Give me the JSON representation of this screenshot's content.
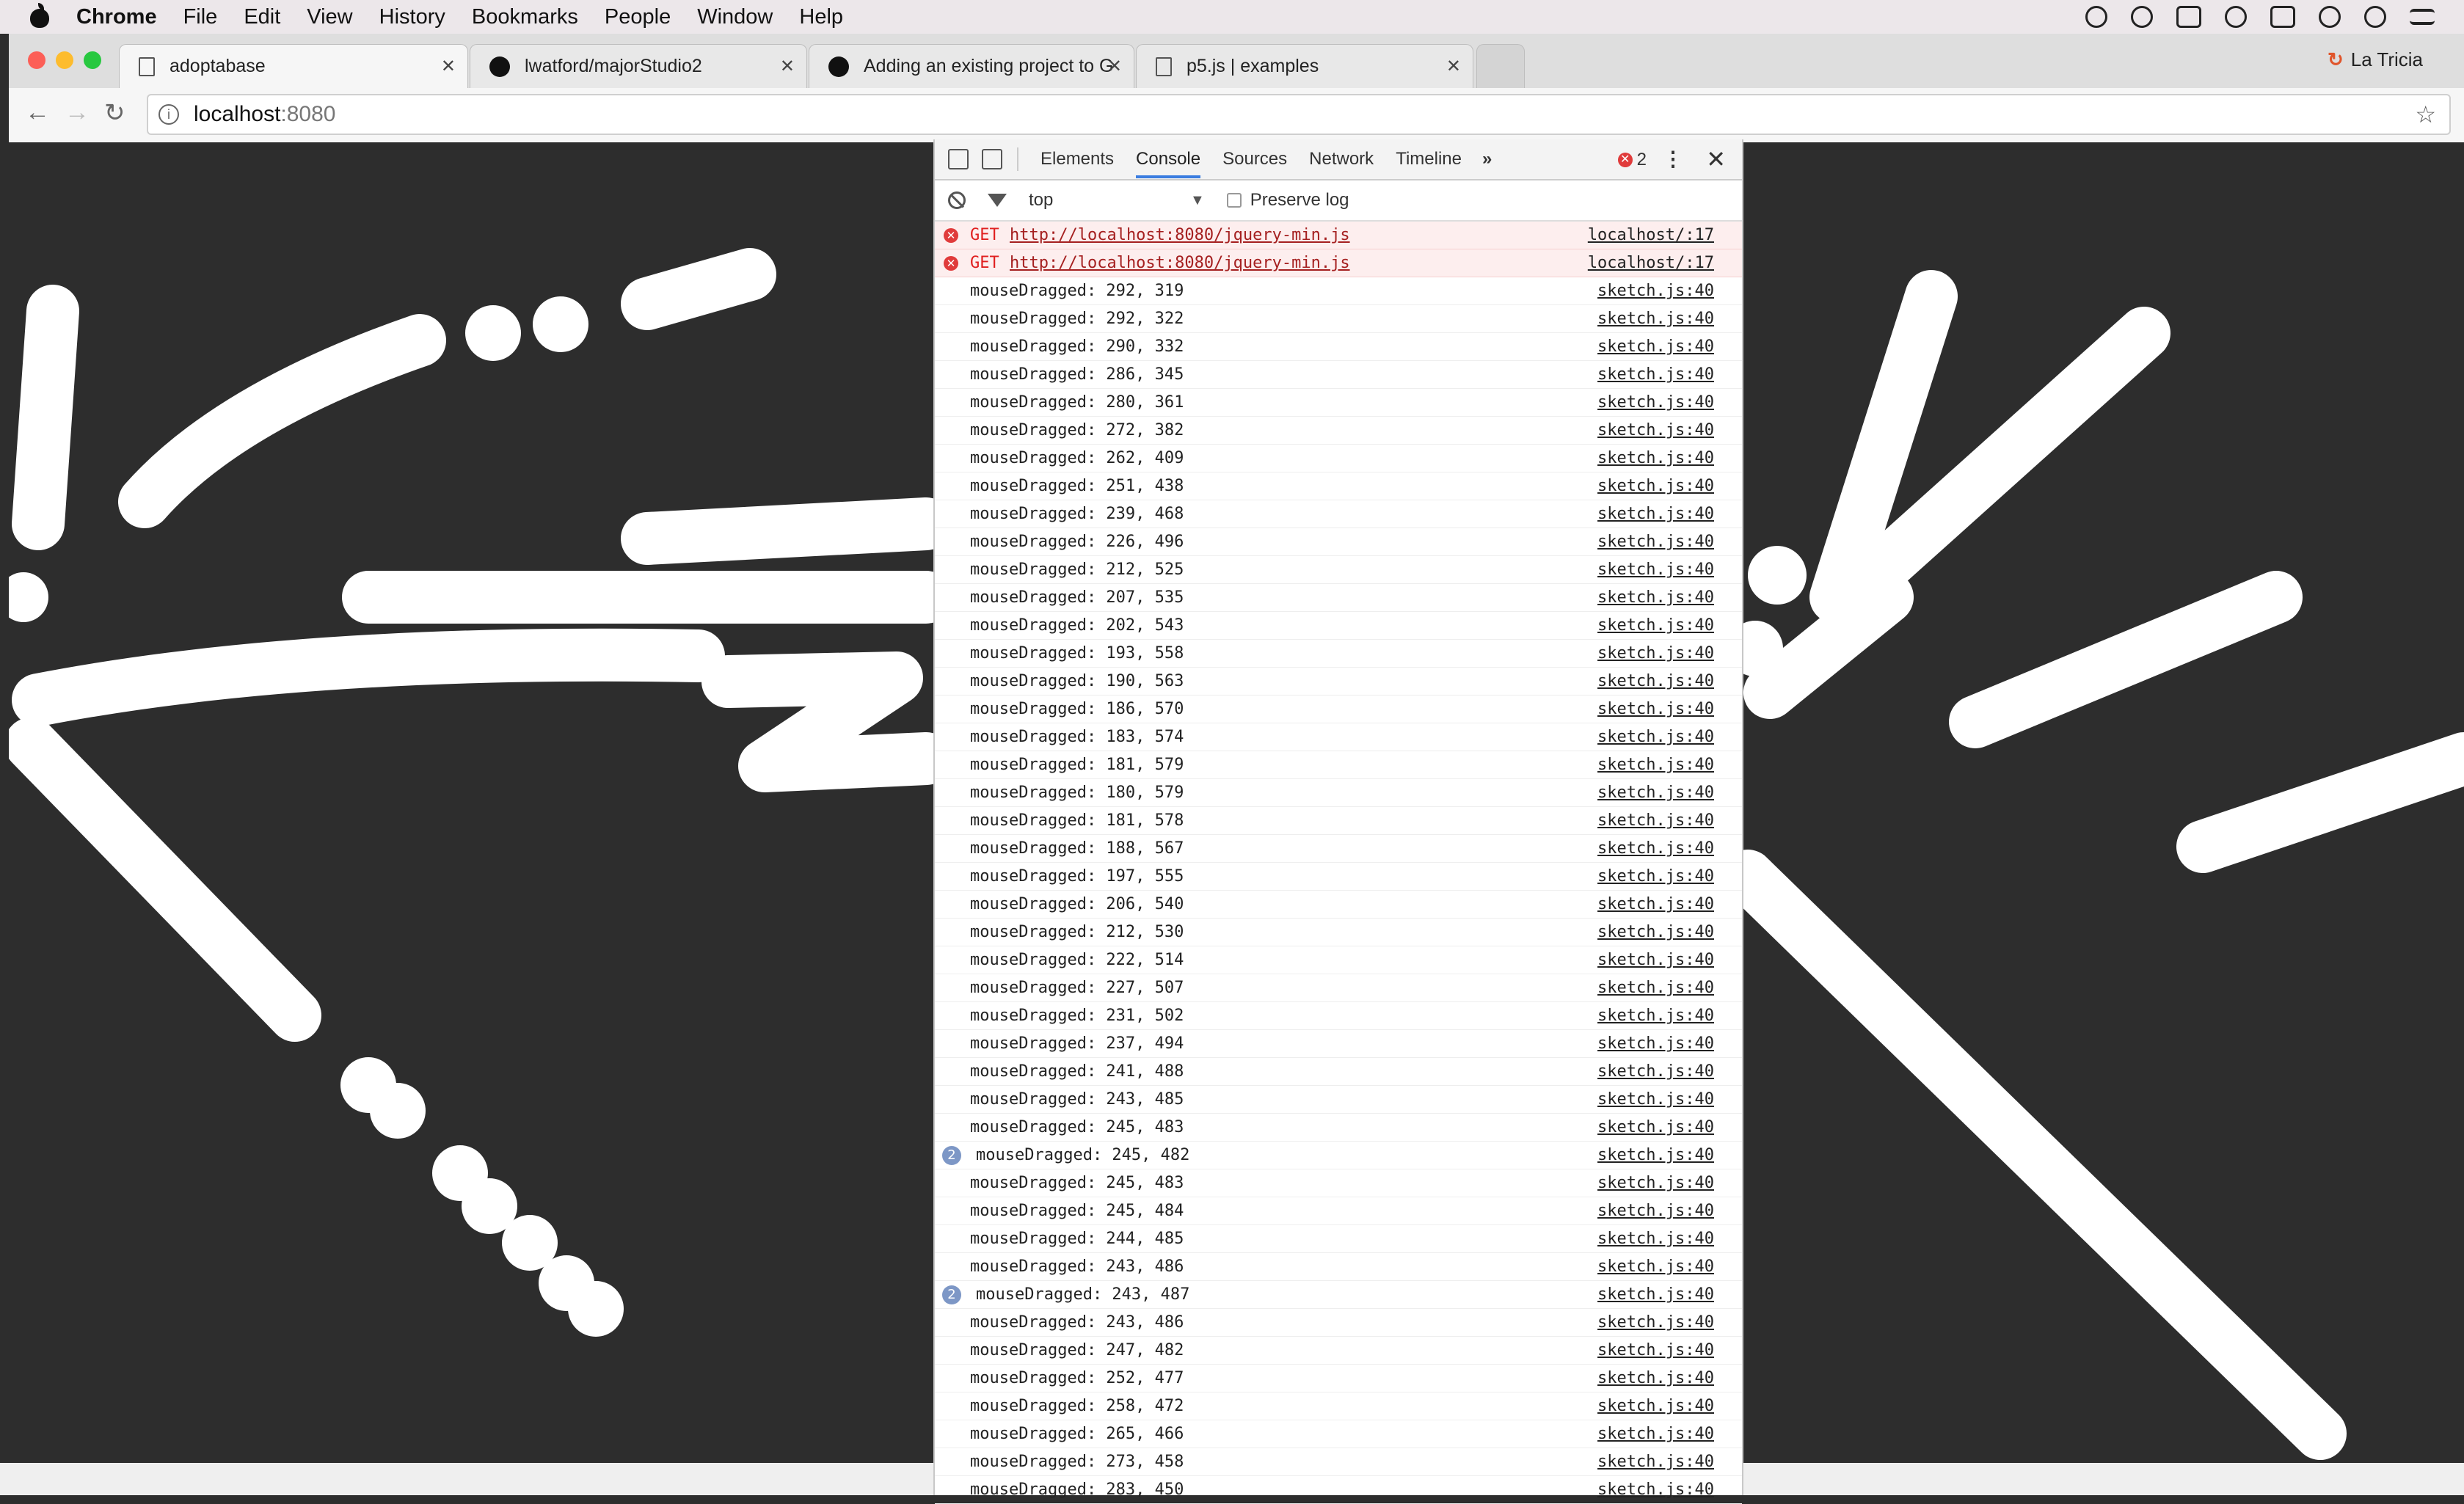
{
  "menubar": {
    "app": "Chrome",
    "items": [
      "File",
      "Edit",
      "View",
      "History",
      "Bookmarks",
      "People",
      "Window",
      "Help"
    ]
  },
  "browser": {
    "tabs": [
      {
        "title": "adoptabase",
        "icon": "page-icon",
        "active": true
      },
      {
        "title": "lwatford/majorStudio2",
        "icon": "github-icon",
        "active": false
      },
      {
        "title": "Adding an existing project to G",
        "icon": "github-icon",
        "active": false
      },
      {
        "title": "p5.js | examples",
        "icon": "page-icon",
        "active": false
      }
    ],
    "profile": "La Tricia",
    "address": {
      "host": "localhost",
      "port": ":8080"
    }
  },
  "devtools": {
    "tabs": [
      "Elements",
      "Console",
      "Sources",
      "Network",
      "Timeline"
    ],
    "active_tab": "Console",
    "error_count": "2",
    "context": "top",
    "preserve_log": "Preserve log",
    "errors": [
      {
        "method": "GET",
        "url": "http://localhost:8080/jquery-min.js",
        "source": "localhost/:17"
      },
      {
        "method": "GET",
        "url": "http://localhost:8080/jquery-min.js",
        "source": "localhost/:17"
      }
    ],
    "logs": [
      {
        "msg": "mouseDragged: 292, 319",
        "src": "sketch.js:40",
        "count": ""
      },
      {
        "msg": "mouseDragged: 292, 322",
        "src": "sketch.js:40",
        "count": ""
      },
      {
        "msg": "mouseDragged: 290, 332",
        "src": "sketch.js:40",
        "count": ""
      },
      {
        "msg": "mouseDragged: 286, 345",
        "src": "sketch.js:40",
        "count": ""
      },
      {
        "msg": "mouseDragged: 280, 361",
        "src": "sketch.js:40",
        "count": ""
      },
      {
        "msg": "mouseDragged: 272, 382",
        "src": "sketch.js:40",
        "count": ""
      },
      {
        "msg": "mouseDragged: 262, 409",
        "src": "sketch.js:40",
        "count": ""
      },
      {
        "msg": "mouseDragged: 251, 438",
        "src": "sketch.js:40",
        "count": ""
      },
      {
        "msg": "mouseDragged: 239, 468",
        "src": "sketch.js:40",
        "count": ""
      },
      {
        "msg": "mouseDragged: 226, 496",
        "src": "sketch.js:40",
        "count": ""
      },
      {
        "msg": "mouseDragged: 212, 525",
        "src": "sketch.js:40",
        "count": ""
      },
      {
        "msg": "mouseDragged: 207, 535",
        "src": "sketch.js:40",
        "count": ""
      },
      {
        "msg": "mouseDragged: 202, 543",
        "src": "sketch.js:40",
        "count": ""
      },
      {
        "msg": "mouseDragged: 193, 558",
        "src": "sketch.js:40",
        "count": ""
      },
      {
        "msg": "mouseDragged: 190, 563",
        "src": "sketch.js:40",
        "count": ""
      },
      {
        "msg": "mouseDragged: 186, 570",
        "src": "sketch.js:40",
        "count": ""
      },
      {
        "msg": "mouseDragged: 183, 574",
        "src": "sketch.js:40",
        "count": ""
      },
      {
        "msg": "mouseDragged: 181, 579",
        "src": "sketch.js:40",
        "count": ""
      },
      {
        "msg": "mouseDragged: 180, 579",
        "src": "sketch.js:40",
        "count": ""
      },
      {
        "msg": "mouseDragged: 181, 578",
        "src": "sketch.js:40",
        "count": ""
      },
      {
        "msg": "mouseDragged: 188, 567",
        "src": "sketch.js:40",
        "count": ""
      },
      {
        "msg": "mouseDragged: 197, 555",
        "src": "sketch.js:40",
        "count": ""
      },
      {
        "msg": "mouseDragged: 206, 540",
        "src": "sketch.js:40",
        "count": ""
      },
      {
        "msg": "mouseDragged: 212, 530",
        "src": "sketch.js:40",
        "count": ""
      },
      {
        "msg": "mouseDragged: 222, 514",
        "src": "sketch.js:40",
        "count": ""
      },
      {
        "msg": "mouseDragged: 227, 507",
        "src": "sketch.js:40",
        "count": ""
      },
      {
        "msg": "mouseDragged: 231, 502",
        "src": "sketch.js:40",
        "count": ""
      },
      {
        "msg": "mouseDragged: 237, 494",
        "src": "sketch.js:40",
        "count": ""
      },
      {
        "msg": "mouseDragged: 241, 488",
        "src": "sketch.js:40",
        "count": ""
      },
      {
        "msg": "mouseDragged: 243, 485",
        "src": "sketch.js:40",
        "count": ""
      },
      {
        "msg": "mouseDragged: 245, 483",
        "src": "sketch.js:40",
        "count": ""
      },
      {
        "msg": "mouseDragged: 245, 482",
        "src": "sketch.js:40",
        "count": "2"
      },
      {
        "msg": "mouseDragged: 245, 483",
        "src": "sketch.js:40",
        "count": ""
      },
      {
        "msg": "mouseDragged: 245, 484",
        "src": "sketch.js:40",
        "count": ""
      },
      {
        "msg": "mouseDragged: 244, 485",
        "src": "sketch.js:40",
        "count": ""
      },
      {
        "msg": "mouseDragged: 243, 486",
        "src": "sketch.js:40",
        "count": ""
      },
      {
        "msg": "mouseDragged: 243, 487",
        "src": "sketch.js:40",
        "count": "2"
      },
      {
        "msg": "mouseDragged: 243, 486",
        "src": "sketch.js:40",
        "count": ""
      },
      {
        "msg": "mouseDragged: 247, 482",
        "src": "sketch.js:40",
        "count": ""
      },
      {
        "msg": "mouseDragged: 252, 477",
        "src": "sketch.js:40",
        "count": ""
      },
      {
        "msg": "mouseDragged: 258, 472",
        "src": "sketch.js:40",
        "count": ""
      },
      {
        "msg": "mouseDragged: 265, 466",
        "src": "sketch.js:40",
        "count": ""
      },
      {
        "msg": "mouseDragged: 273, 458",
        "src": "sketch.js:40",
        "count": ""
      },
      {
        "msg": "mouseDragged: 283, 450",
        "src": "sketch.js:40",
        "count": ""
      }
    ]
  },
  "colors": {
    "canvas_bg": "#2d2d2d",
    "stroke": "#ffffff",
    "error": "#e03b3b",
    "accent": "#3b7de0"
  }
}
